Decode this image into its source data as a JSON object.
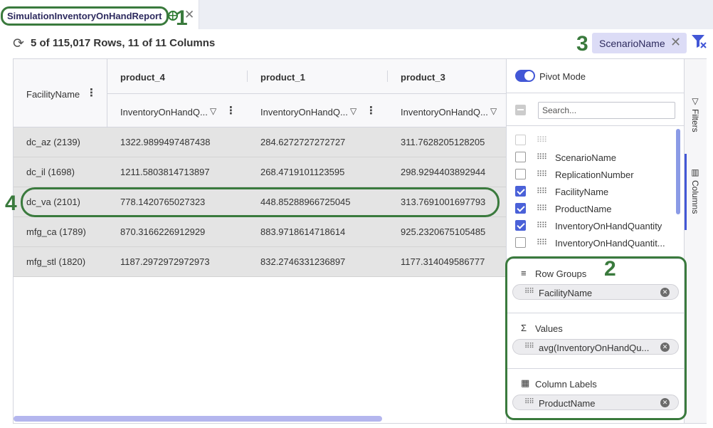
{
  "tab": {
    "title": "SimulationInventoryOnHandReport",
    "close_glyph": "✕"
  },
  "info_bar": {
    "refresh_glyph": "⟳",
    "row_count": "5 of 115,017 Rows, 11 of 11 Columns",
    "filter_chip": {
      "label": "ScenarioName",
      "close_glyph": "✕"
    }
  },
  "grid": {
    "row_group_header": "FacilityName",
    "columns": [
      {
        "group": "product_4",
        "field": "InventoryOnHandQ..."
      },
      {
        "group": "product_1",
        "field": "InventoryOnHandQ..."
      },
      {
        "group": "product_3",
        "field": "InventoryOnHandQ..."
      }
    ],
    "rows": [
      {
        "facility": "dc_az (2139)",
        "values": [
          "1322.9899497487438",
          "284.6272727272727",
          "311.7628205128205"
        ]
      },
      {
        "facility": "dc_il (1698)",
        "values": [
          "1211.5803814713897",
          "268.4719101123595",
          "298.9294403892944"
        ]
      },
      {
        "facility": "dc_va (2101)",
        "values": [
          "778.1420765027323",
          "448.85288966725045",
          "313.7691001697793"
        ]
      },
      {
        "facility": "mfg_ca (1789)",
        "values": [
          "870.3166226912929",
          "883.9718614718614",
          "925.2320675105485"
        ]
      },
      {
        "facility": "mfg_stl (1820)",
        "values": [
          "1187.2972972972973",
          "832.2746331236897",
          "1177.314049586777"
        ]
      }
    ]
  },
  "panel": {
    "pivot_mode_label": "Pivot Mode",
    "search_placeholder": "Search...",
    "column_list": [
      {
        "name": "",
        "checked": false
      },
      {
        "name": "ScenarioName",
        "checked": false
      },
      {
        "name": "ReplicationNumber",
        "checked": false
      },
      {
        "name": "FacilityName",
        "checked": true
      },
      {
        "name": "ProductName",
        "checked": true
      },
      {
        "name": "InventoryOnHandQuantity",
        "checked": true
      },
      {
        "name": "InventoryOnHandQuantit...",
        "checked": false
      }
    ],
    "row_groups": {
      "label": "Row Groups",
      "icon": "≡",
      "pill": "FacilityName"
    },
    "values": {
      "label": "Values",
      "icon": "Σ",
      "pill": "avg(InventoryOnHandQu..."
    },
    "column_labels": {
      "label": "Column Labels",
      "icon": "▦",
      "pill": "ProductName"
    }
  },
  "side_tabs": {
    "filters": "Filters",
    "columns": "Columns"
  },
  "annotations": {
    "n1": "1",
    "n2": "2",
    "n3": "3",
    "n4": "4",
    "color": "#3a7a3d"
  },
  "colors": {
    "accent": "#4257d6",
    "checkbox": "#4a61d8",
    "chip_bg": "#dcdcf6",
    "row_bg": "#e4e4e4"
  }
}
